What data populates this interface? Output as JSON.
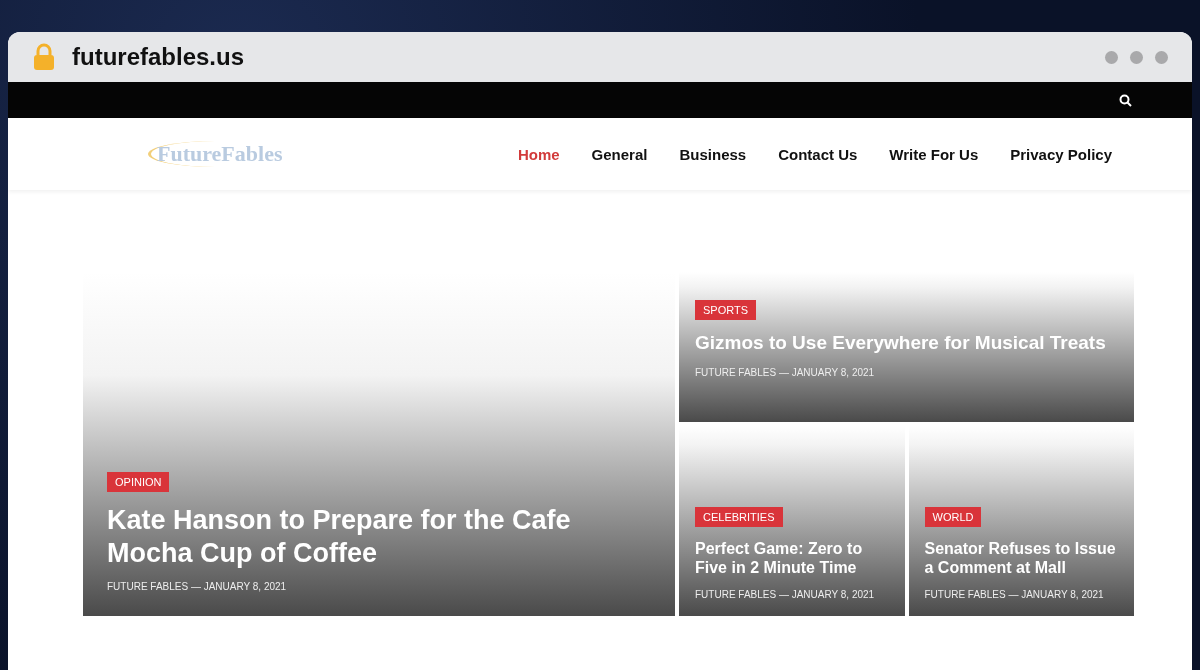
{
  "browser": {
    "url": "futurefables.us"
  },
  "site": {
    "logo": "FutureFables",
    "nav": [
      {
        "label": "Home",
        "selected": true
      },
      {
        "label": "General",
        "selected": false
      },
      {
        "label": "Business",
        "selected": false
      },
      {
        "label": "Contact Us",
        "selected": false
      },
      {
        "label": "Write For Us",
        "selected": false
      },
      {
        "label": "Privacy Policy",
        "selected": false
      }
    ]
  },
  "posts": [
    {
      "category": "OPINION",
      "title": "Kate Hanson to Prepare for the Cafe Mocha Cup of Coffee",
      "meta": "FUTURE FABLES — JANUARY 8, 2021"
    },
    {
      "category": "SPORTS",
      "title": "Gizmos to Use Everywhere for Musical Treats",
      "meta": "FUTURE FABLES — JANUARY 8, 2021"
    },
    {
      "category": "CELEBRITIES",
      "title": "Perfect Game: Zero to Five in 2 Minute Time",
      "meta": "FUTURE FABLES — JANUARY 8, 2021"
    },
    {
      "category": "WORLD",
      "title": "Senator Refuses to Issue a Comment at Mall",
      "meta": "FUTURE FABLES — JANUARY 8, 2021"
    }
  ]
}
